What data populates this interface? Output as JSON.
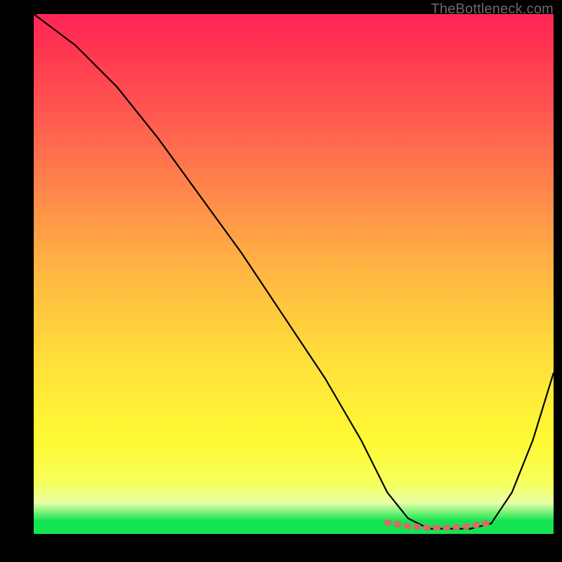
{
  "watermark": "TheBottleneck.com",
  "chart_data": {
    "type": "line",
    "title": "",
    "xlabel": "",
    "ylabel": "",
    "xlim": [
      0,
      100
    ],
    "ylim": [
      0,
      100
    ],
    "grid": false,
    "legend": false,
    "series": [
      {
        "name": "bottleneck-curve",
        "x": [
          0,
          8,
          16,
          24,
          32,
          40,
          48,
          56,
          63,
          68,
          72,
          76,
          80,
          84,
          88,
          92,
          96,
          100
        ],
        "y": [
          100,
          94,
          86,
          76,
          65,
          54,
          42,
          30,
          18,
          8,
          3,
          1,
          1,
          1,
          2,
          8,
          18,
          31
        ]
      },
      {
        "name": "highlight-band",
        "x": [
          68,
          72,
          76,
          80,
          84,
          88
        ],
        "y": [
          2.2,
          1.5,
          1.2,
          1.2,
          1.5,
          2.2
        ]
      }
    ],
    "gradient_stops": [
      {
        "pos": 0.0,
        "color": "#ff2558"
      },
      {
        "pos": 0.2,
        "color": "#ff5a50"
      },
      {
        "pos": 0.5,
        "color": "#ffb842"
      },
      {
        "pos": 0.82,
        "color": "#fff933"
      },
      {
        "pos": 0.975,
        "color": "#14e451"
      },
      {
        "pos": 1.0,
        "color": "#14e451"
      }
    ],
    "highlight_color": "#d86a6a"
  }
}
